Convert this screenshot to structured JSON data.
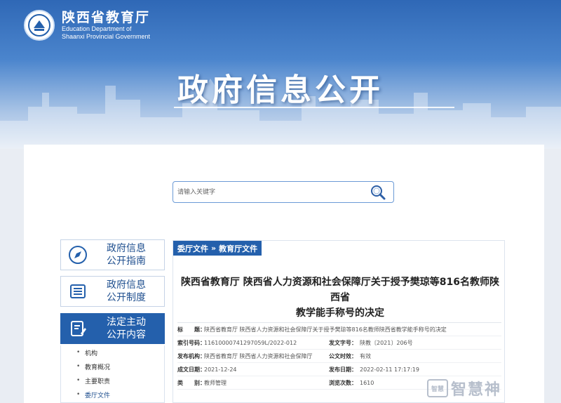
{
  "header": {
    "org_cn": "陕西省教育厅",
    "org_en_line1": "Education Department of",
    "org_en_line2": "Shaanxi Provincial Government",
    "hero_title": "政府信息公开"
  },
  "search": {
    "placeholder": "请输入关键字",
    "button_icon": "search-icon"
  },
  "nav": {
    "items": [
      {
        "label_line1": "政府信息",
        "label_line2": "公开指南",
        "icon": "compass-icon"
      },
      {
        "label_line1": "政府信息",
        "label_line2": "公开制度",
        "icon": "document-list-icon"
      },
      {
        "label_line1": "法定主动",
        "label_line2": "公开内容",
        "icon": "edit-document-icon"
      }
    ],
    "sub_items": [
      "机构",
      "教育概况",
      "主要职责",
      "委厅文件"
    ]
  },
  "article": {
    "breadcrumb": [
      "委厅文件",
      "教育厅文件"
    ],
    "breadcrumb_sep": "»",
    "title_line1": "陕西省教育厅 陕西省人力资源和社会保障厅关于授予樊琼等816名教师陕西省",
    "title_line2": "教学能手称号的决定",
    "meta": {
      "subject_key": "标　　题：",
      "subject_val": "陕西省教育厅 陕西省人力资源和社会保障厅关于授予樊琼等816名教师陕西省教学能手称号的决定",
      "index_key": "索引号码：",
      "index_val": "11610000741297059L/2022-012",
      "docno_key": "发文字号：",
      "docno_val": "陕教〔2021〕206号",
      "issuer_key": "发布机构：",
      "issuer_val": "陕西省教育厅 陕西省人力资源和社会保障厅",
      "status_key": "公文时效：",
      "status_val": "有效",
      "created_key": "成文日期：",
      "created_val": "2021-12-24",
      "published_key": "发布日期：",
      "published_val": "2022-02-11 17:17:19",
      "category_key": "类　　别：",
      "category_val": "教师管理",
      "views_key": "浏览次数：",
      "views_val": "1610"
    }
  },
  "watermark": {
    "badge": "智慧",
    "text": "智慧神"
  },
  "colors": {
    "primary": "#2460ac",
    "banner_top": "#2f68b6"
  }
}
